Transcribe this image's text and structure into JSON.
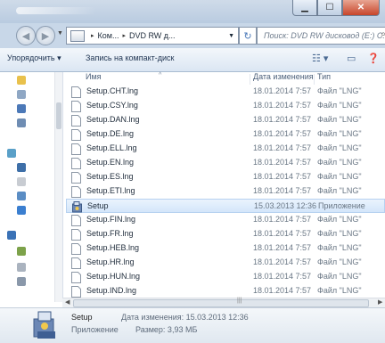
{
  "address": {
    "crumbs": [
      "Ком...",
      "DVD RW д..."
    ]
  },
  "search": {
    "placeholder": "Поиск: DVD RW дисковод (E:) С..."
  },
  "toolbar": {
    "organize": "Упорядочить",
    "burn": "Запись на компакт-диск"
  },
  "columns": {
    "name": "Имя",
    "date": "Дата изменения",
    "type": "Тип"
  },
  "files": [
    {
      "name": "Setup.CHT.lng",
      "date": "18.01.2014 7:57",
      "type": "Файл \"LNG\""
    },
    {
      "name": "Setup.CSY.lng",
      "date": "18.01.2014 7:57",
      "type": "Файл \"LNG\""
    },
    {
      "name": "Setup.DAN.lng",
      "date": "18.01.2014 7:57",
      "type": "Файл \"LNG\""
    },
    {
      "name": "Setup.DE.lng",
      "date": "18.01.2014 7:57",
      "type": "Файл \"LNG\""
    },
    {
      "name": "Setup.ELL.lng",
      "date": "18.01.2014 7:57",
      "type": "Файл \"LNG\""
    },
    {
      "name": "Setup.EN.lng",
      "date": "18.01.2014 7:57",
      "type": "Файл \"LNG\""
    },
    {
      "name": "Setup.ES.lng",
      "date": "18.01.2014 7:57",
      "type": "Файл \"LNG\""
    },
    {
      "name": "Setup.ETI.lng",
      "date": "18.01.2014 7:57",
      "type": "Файл \"LNG\""
    },
    {
      "name": "Setup",
      "date": "15.03.2013 12:36",
      "type": "Приложение"
    },
    {
      "name": "Setup.FIN.lng",
      "date": "18.01.2014 7:57",
      "type": "Файл \"LNG\""
    },
    {
      "name": "Setup.FR.lng",
      "date": "18.01.2014 7:57",
      "type": "Файл \"LNG\""
    },
    {
      "name": "Setup.HEB.lng",
      "date": "18.01.2014 7:57",
      "type": "Файл \"LNG\""
    },
    {
      "name": "Setup.HR.lng",
      "date": "18.01.2014 7:57",
      "type": "Файл \"LNG\""
    },
    {
      "name": "Setup.HUN.lng",
      "date": "18.01.2014 7:57",
      "type": "Файл \"LNG\""
    },
    {
      "name": "Setup.IND.lng",
      "date": "18.01.2014 7:57",
      "type": "Файл \"LNG\""
    }
  ],
  "details": {
    "name": "Setup",
    "type": "Приложение",
    "modified": "Дата изменения: 15.03.2013 12:36",
    "size": "Размер: 3,93 МБ"
  },
  "colors": {
    "selection": "#d4e6fa",
    "titlebar": "#b9cbe0",
    "close": "#c7452a"
  }
}
